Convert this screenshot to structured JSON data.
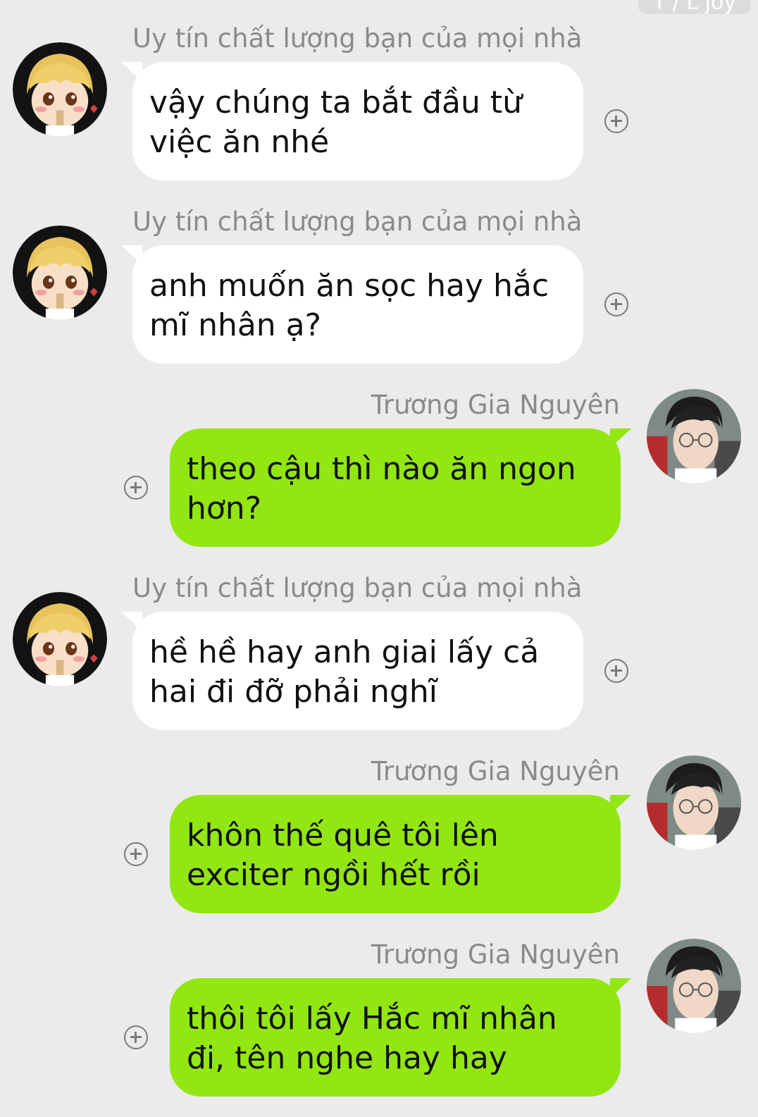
{
  "top_chip": {
    "text": "T / L joy"
  },
  "contacts": {
    "left_name": "Uy tín chất lượng bạn của mọi nhà",
    "right_name": "Trương Gia Nguyên"
  },
  "messages": [
    {
      "sender": "Uy tín chất lượng bạn của mọi nhà",
      "text": "vậy chúng ta bắt đầu từ việc ăn nhé",
      "side": "left"
    },
    {
      "sender": "Uy tín chất lượng bạn của mọi nhà",
      "text": "anh muốn ăn sọc hay hắc mĩ nhân ạ?",
      "side": "left"
    },
    {
      "sender": "Trương Gia Nguyên",
      "text": "theo cậu thì nào ăn ngon hơn?",
      "side": "right"
    },
    {
      "sender": "Uy tín chất lượng bạn của mọi nhà",
      "text": "hề hề hay anh giai lấy cả hai đi đỡ phải nghĩ",
      "side": "left"
    },
    {
      "sender": "Trương Gia Nguyên",
      "text": "khôn thế quê tôi lên exciter ngồi hết rồi",
      "side": "right"
    },
    {
      "sender": "Trương Gia Nguyên",
      "text": "thôi tôi lấy Hắc mĩ nhân đi, tên nghe hay hay",
      "side": "right"
    }
  ],
  "colors": {
    "background": "#ebebeb",
    "incoming_bubble": "#ffffff",
    "outgoing_bubble": "#92e612",
    "sender_text": "#8a8a8a"
  },
  "icons": {
    "react_button": "plus-circle-icon",
    "avatar_left": "cartoon-avatar-icon",
    "avatar_right": "photo-avatar-icon"
  }
}
